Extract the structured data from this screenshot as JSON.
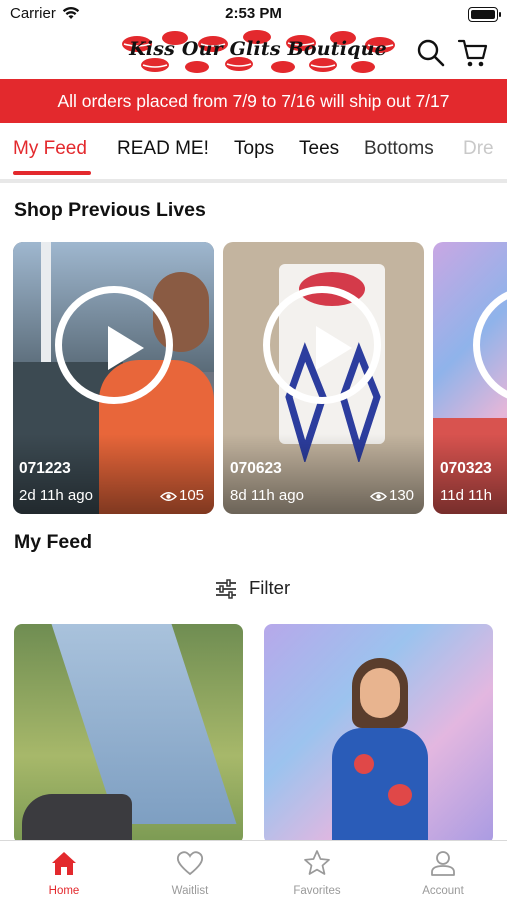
{
  "status_bar": {
    "carrier": "Carrier",
    "time": "2:53 PM"
  },
  "header": {
    "logo_text": "Kiss Our Glits Boutique"
  },
  "banner": {
    "text": "All orders placed from 7/9 to 7/16 will ship out 7/17"
  },
  "tabs": [
    {
      "label": "My Feed",
      "active": true
    },
    {
      "label": "READ ME!"
    },
    {
      "label": "Tops"
    },
    {
      "label": "Tees"
    },
    {
      "label": "Bottoms"
    },
    {
      "label": "Dre"
    }
  ],
  "previous_lives": {
    "title": "Shop Previous Lives",
    "cards": [
      {
        "code": "071223",
        "age": "2d 11h ago",
        "views": "105"
      },
      {
        "code": "070623",
        "age": "8d 11h ago",
        "views": "130"
      },
      {
        "code": "070323",
        "age": "11d 11h"
      }
    ]
  },
  "my_feed": {
    "title": "My Feed",
    "filter_label": "Filter"
  },
  "tab_bar": [
    {
      "label": "Home",
      "icon": "home-icon",
      "active": true
    },
    {
      "label": "Waitlist",
      "icon": "heart-icon"
    },
    {
      "label": "Favorites",
      "icon": "star-icon"
    },
    {
      "label": "Account",
      "icon": "account-icon"
    }
  ],
  "colors": {
    "accent": "#e3292d",
    "inactive": "#9a9a9a"
  }
}
